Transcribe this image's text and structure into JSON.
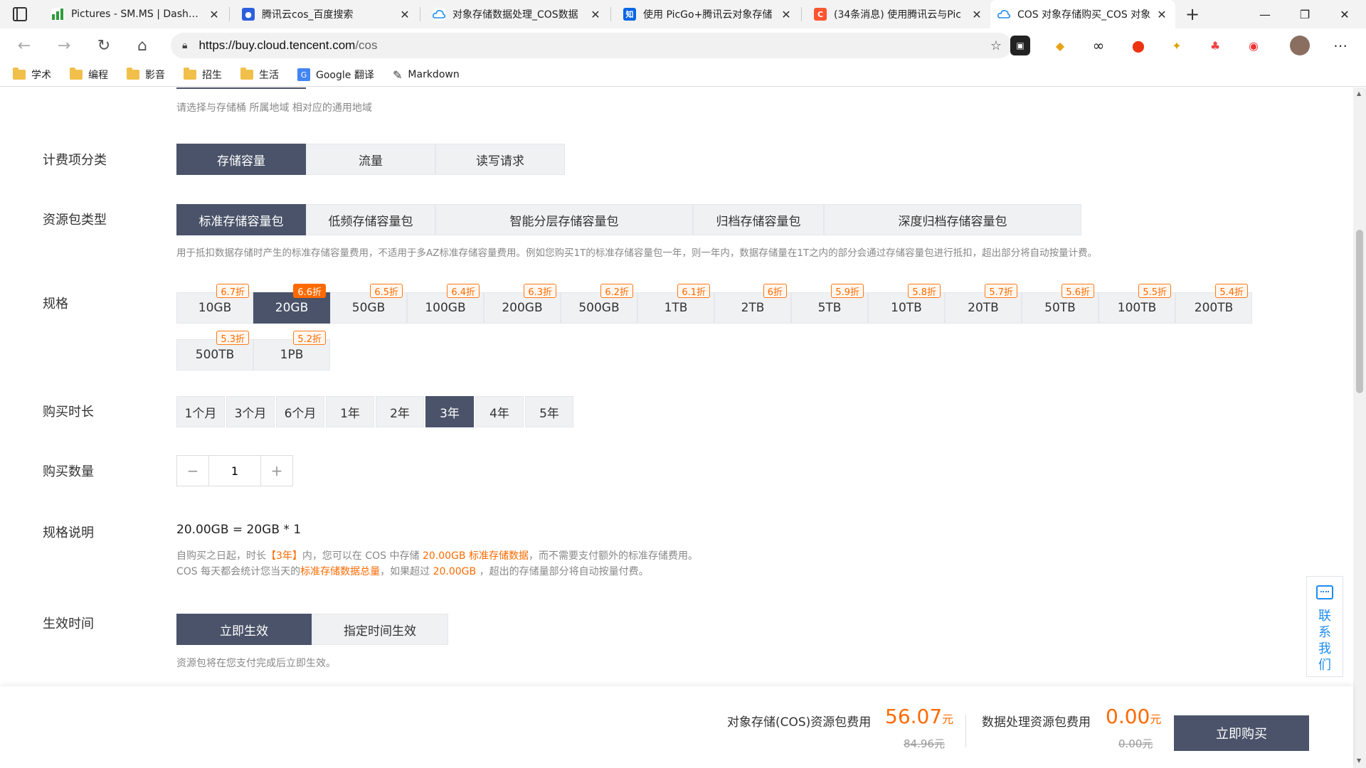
{
  "browser": {
    "tabs": [
      {
        "title": "Pictures - SM.MS | Dashboa",
        "icon": "bar-chart-icon",
        "color": "#2e9c3a"
      },
      {
        "title": "腾讯云cos_百度搜索",
        "icon": "baidu-paw-icon",
        "color": "#2b60de"
      },
      {
        "title": "对象存储数据处理_COS数据",
        "icon": "cloud-icon",
        "color": "#1e8cf0"
      },
      {
        "title": "使用 PicGo+腾讯云对象存储",
        "icon": "zhihu-icon",
        "color": "#0a66e4"
      },
      {
        "title": "(34条消息) 使用腾讯云与Pic",
        "icon": "csdn-icon",
        "color": "#fc5531"
      },
      {
        "title": "COS 对象存储购买_COS 对象",
        "icon": "cloud-icon",
        "color": "#1e8cf0"
      }
    ],
    "url_host": "https://buy.cloud.tencent.com",
    "url_path": "/cos",
    "bookmarks": [
      {
        "label": "学术",
        "type": "folder"
      },
      {
        "label": "编程",
        "type": "folder"
      },
      {
        "label": "影音",
        "type": "folder"
      },
      {
        "label": "招生",
        "type": "folder"
      },
      {
        "label": "生活",
        "type": "folder"
      },
      {
        "label": "Google 翻译",
        "type": "translate"
      },
      {
        "label": "Markdown",
        "type": "markdown"
      }
    ]
  },
  "page": {
    "region_hint": "请选择与存储桶 所属地域 相对应的通用地域",
    "billing": {
      "label": "计费项分类",
      "options": [
        "存储容量",
        "流量",
        "读写请求"
      ],
      "selected": 0
    },
    "package_type": {
      "label": "资源包类型",
      "options": [
        "标准存储容量包",
        "低频存储容量包",
        "智能分层存储容量包",
        "归档存储容量包",
        "深度归档存储容量包"
      ],
      "selected": 0,
      "hint": "用于抵扣数据存储时产生的标准存储容量费用，不适用于多AZ标准存储容量费用。例如您购买1T的标准存储容量包一年，则一年内，数据存储量在1T之内的部分会通过存储容量包进行抵扣，超出部分将自动按量计费。"
    },
    "spec": {
      "label": "规格",
      "items": [
        {
          "size": "10GB",
          "discount": "6.7折"
        },
        {
          "size": "20GB",
          "discount": "6.6折"
        },
        {
          "size": "50GB",
          "discount": "6.5折"
        },
        {
          "size": "100GB",
          "discount": "6.4折"
        },
        {
          "size": "200GB",
          "discount": "6.3折"
        },
        {
          "size": "500GB",
          "discount": "6.2折"
        },
        {
          "size": "1TB",
          "discount": "6.1折"
        },
        {
          "size": "2TB",
          "discount": "6折"
        },
        {
          "size": "5TB",
          "discount": "5.9折"
        },
        {
          "size": "10TB",
          "discount": "5.8折"
        },
        {
          "size": "20TB",
          "discount": "5.7折"
        },
        {
          "size": "50TB",
          "discount": "5.6折"
        },
        {
          "size": "100TB",
          "discount": "5.5折"
        },
        {
          "size": "200TB",
          "discount": "5.4折"
        },
        {
          "size": "500TB",
          "discount": "5.3折"
        },
        {
          "size": "1PB",
          "discount": "5.2折"
        }
      ],
      "selected": 1
    },
    "duration": {
      "label": "购买时长",
      "options": [
        "1个月",
        "3个月",
        "6个月",
        "1年",
        "2年",
        "3年",
        "4年",
        "5年"
      ],
      "selected": 5
    },
    "quantity": {
      "label": "购买数量",
      "value": "1",
      "minus": "−",
      "plus": "+"
    },
    "spec_desc": {
      "label": "规格说明",
      "formula": "20.00GB = 20GB * 1",
      "line1_a": "自购买之日起，时长",
      "line1_b": "【3年】",
      "line1_c": "内，您可以在 COS 中存储",
      "line1_d": "20.00GB 标准存储数据",
      "line1_e": "，而不需要支付额外的标准存储费用。",
      "line2_a": "COS 每天都会统计您当天的",
      "line2_b": "标准存储数据总量",
      "line2_c": "，如果超过",
      "line2_d": "20.00GB",
      "line2_e": "，超出的存储量部分将自动按量付费。"
    },
    "effective": {
      "label": "生效时间",
      "options": [
        "立即生效",
        "指定时间生效"
      ],
      "selected": 0,
      "hint": "资源包将在您支付完成后立即生效。"
    }
  },
  "contact": {
    "label_chars": [
      "联",
      "系",
      "我",
      "们"
    ]
  },
  "bottom": {
    "cos_fee_label": "对象存储(COS)资源包费用",
    "cos_fee": "56.07",
    "cos_unit": "元",
    "cos_original": "84.96元",
    "dp_fee_label": "数据处理资源包费用",
    "dp_fee": "0.00",
    "dp_unit": "元",
    "dp_original": "0.00元",
    "buy_label": "立即购买"
  },
  "colors": {
    "selected_bg": "#4a5369",
    "accent_orange": "#ff6a00",
    "contact_blue": "#1e8cf0"
  }
}
